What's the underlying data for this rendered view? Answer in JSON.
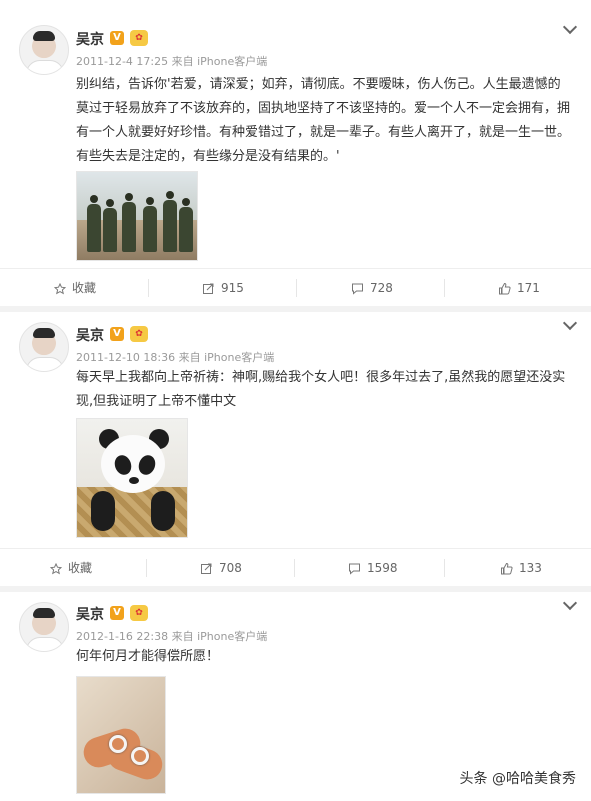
{
  "posts": [
    {
      "user": "吴京",
      "meta": "2011-12-4 17:25 来自 iPhone客户端",
      "text": "别纠结，告诉你'若爱，请深爱；如弃，请彻底。不要暧昧，伤人伤己。人生最遗憾的莫过于轻易放弃了不该放弃的，固执地坚持了不该坚持的。爱一个人不一定会拥有，拥有一个人就要好好珍惜。有种爱错过了，就是一辈子。有些人离开了，就是一生一世。有些失去是注定的，有些缘分是没有结果的。'",
      "actions": {
        "collect": "收藏",
        "repost": "915",
        "comment": "728",
        "like": "171"
      }
    },
    {
      "user": "吴京",
      "meta": "2011-12-10 18:36 来自 iPhone客户端",
      "text": "每天早上我都向上帝祈祷：神啊,赐给我个女人吧！很多年过去了,虽然我的愿望还没实现,但我证明了上帝不懂中文",
      "actions": {
        "collect": "收藏",
        "repost": "708",
        "comment": "1598",
        "like": "133"
      }
    },
    {
      "user": "吴京",
      "meta": "2012-1-16 22:38 来自 iPhone客户端",
      "text": "何年何月才能得偿所愿！"
    }
  ],
  "badges": {
    "v": "V"
  },
  "watermark": "头条 @哈哈美食秀",
  "colors": {
    "accent_badge": "#f2a21b",
    "text": "#333333",
    "meta": "#9a9a9a",
    "background": "#f2f2f2"
  }
}
